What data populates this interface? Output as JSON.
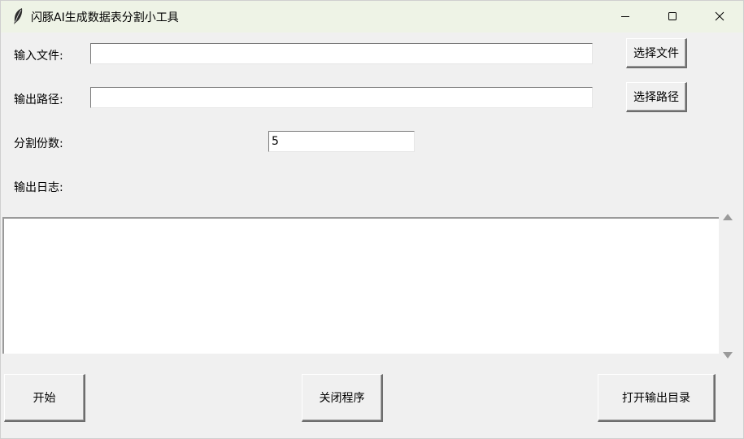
{
  "window": {
    "title": "闪豚AI生成数据表分割小工具",
    "icon": "feather-icon",
    "controls": [
      "minimize-icon",
      "maximize-icon",
      "close-icon"
    ]
  },
  "form": {
    "input_file_label": "输入文件:",
    "input_file_value": "",
    "choose_file_button": "选择文件",
    "output_path_label": "输出路径:",
    "output_path_value": "",
    "choose_path_button": "选择路径",
    "split_count_label": "分割份数:",
    "split_count_value": "5",
    "log_label": "输出日志:",
    "log_text": ""
  },
  "actions": {
    "start_button": "开始",
    "close_button": "关闭程序",
    "open_output_button": "打开输出目录"
  }
}
